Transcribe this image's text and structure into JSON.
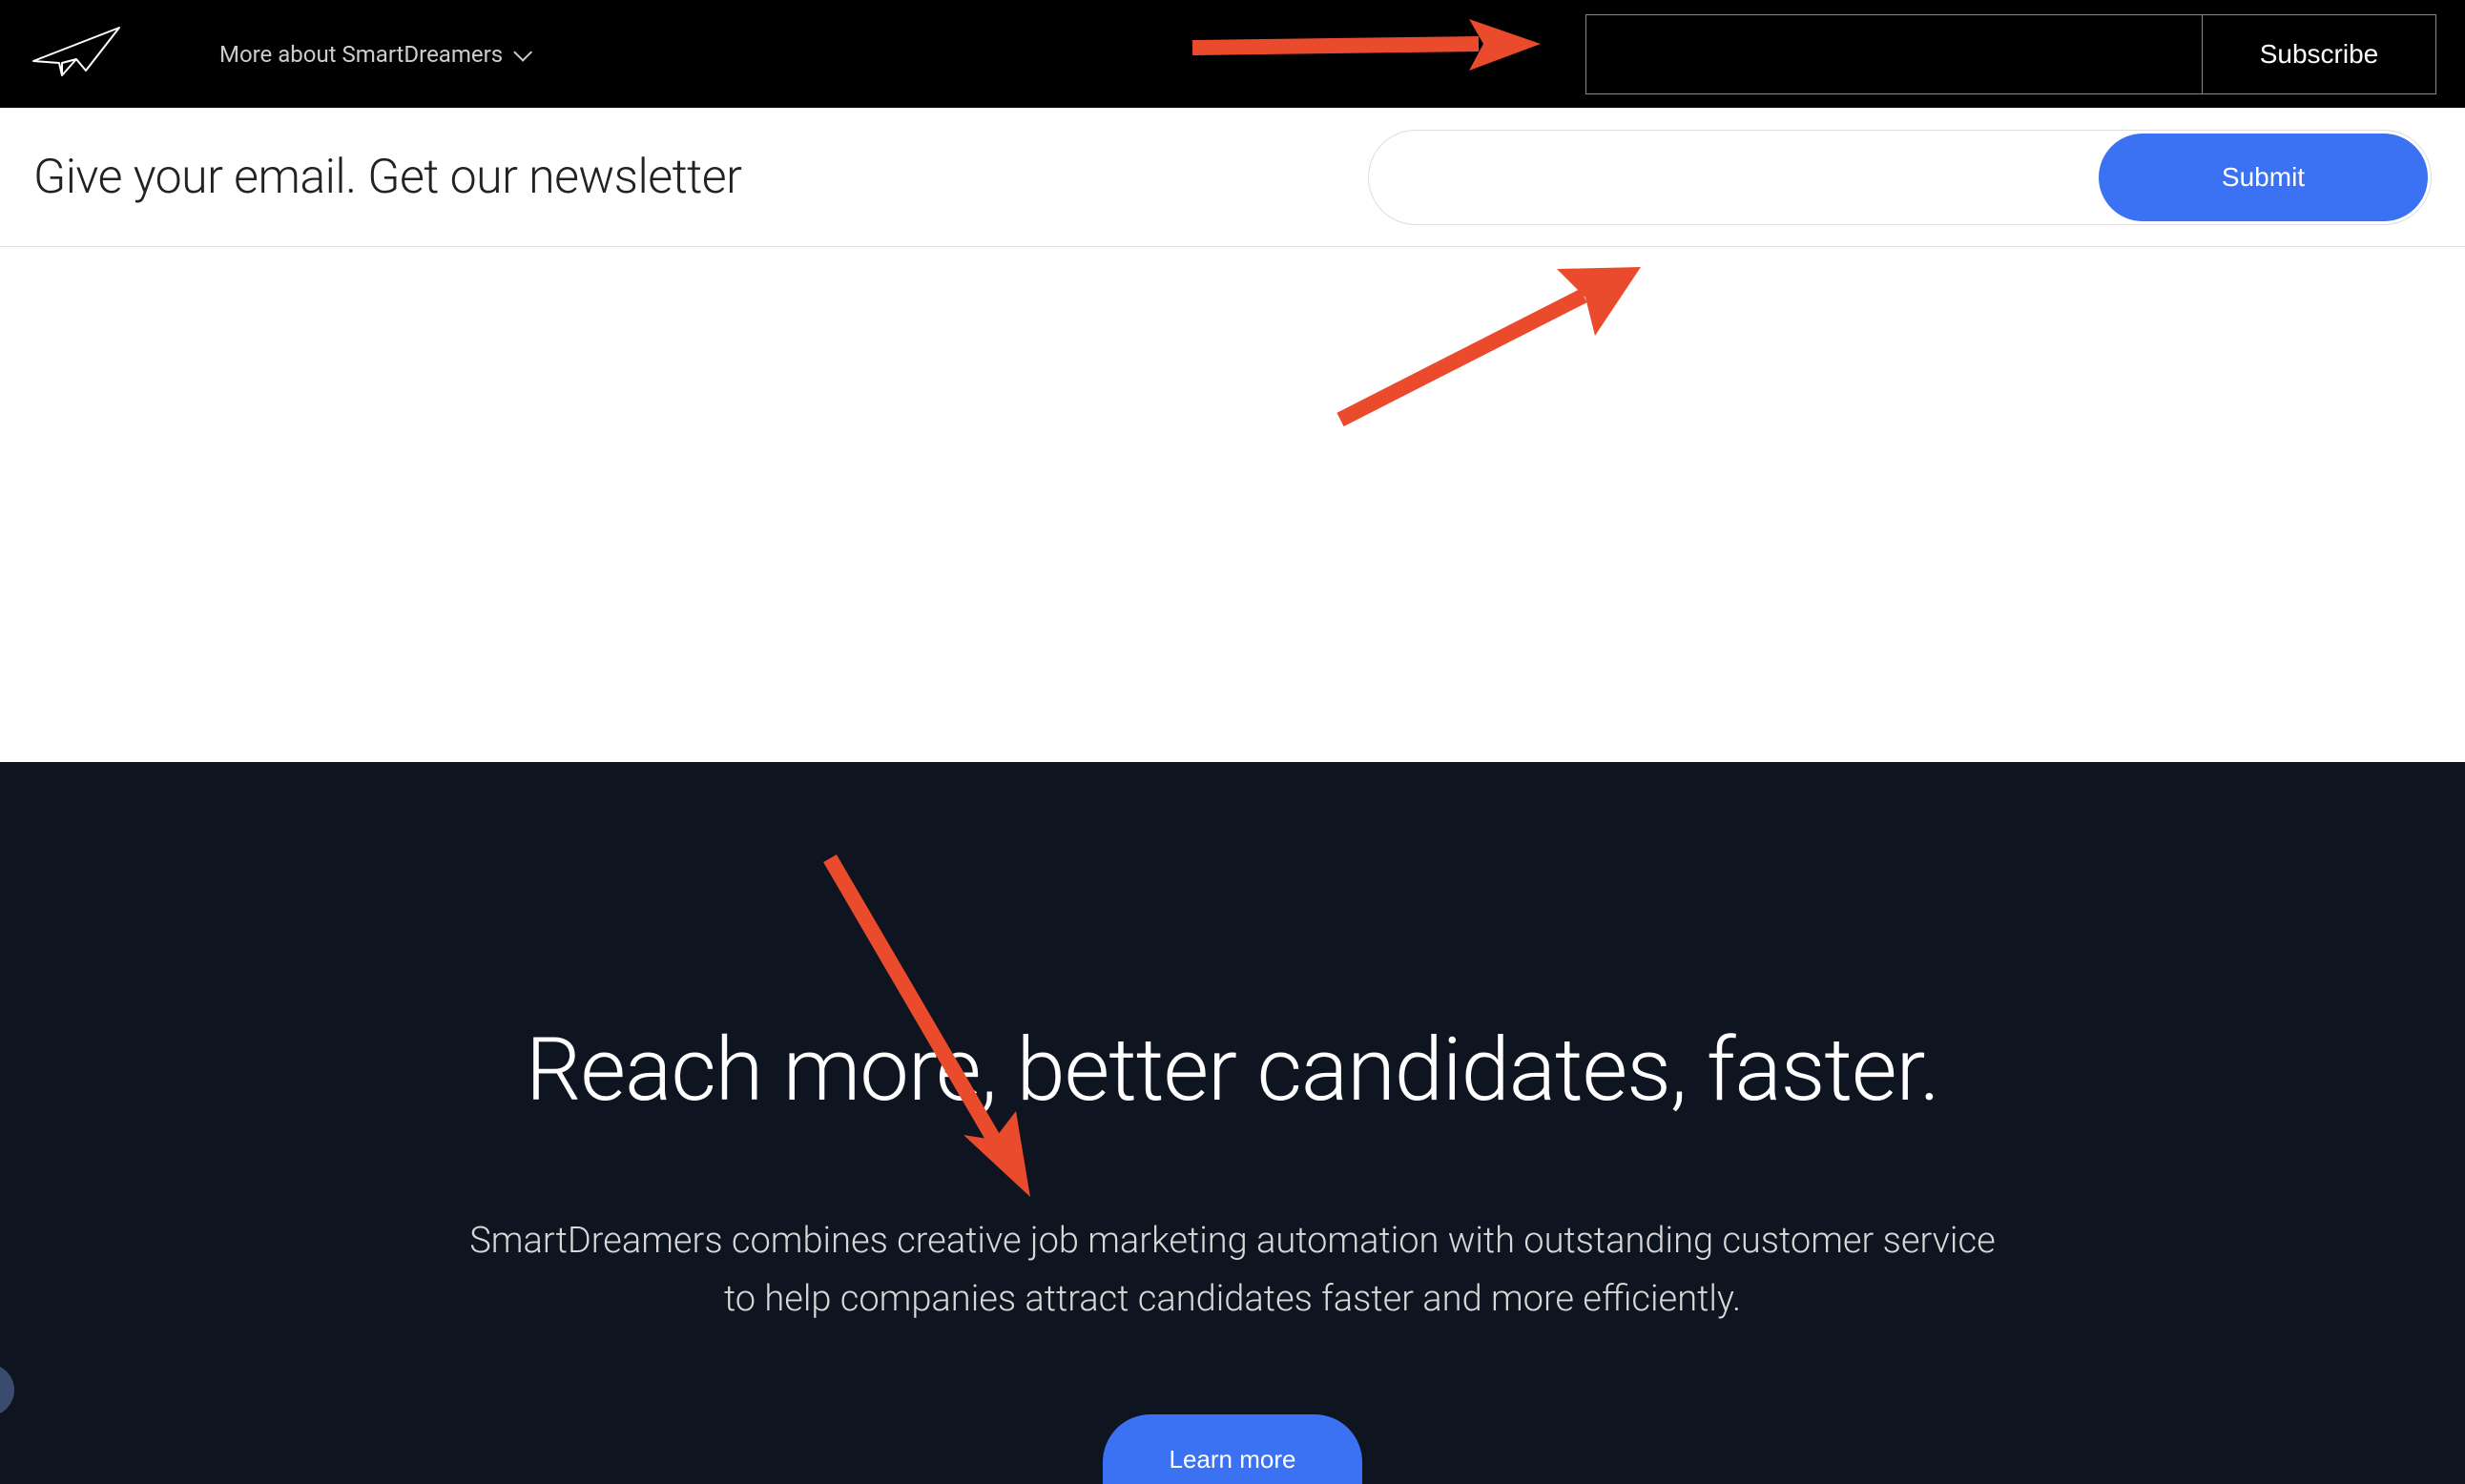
{
  "header": {
    "nav_label": "More about SmartDreamers",
    "subscribe_button": "Subscribe"
  },
  "newsletter": {
    "heading": "Give your email. Get our newsletter",
    "submit_button": "Submit"
  },
  "hero": {
    "headline": "Reach more, better candidates, faster.",
    "subtext": "SmartDreamers combines creative job marketing automation with outstanding customer service to help companies attract candidates faster and more efficiently.",
    "cta_button": "Learn more"
  },
  "annotations": {
    "arrows": [
      {
        "target": "subscribe-input",
        "color": "#e94b2c"
      },
      {
        "target": "newsletter-input",
        "color": "#e94b2c"
      },
      {
        "target": "hero-subtext",
        "color": "#e94b2c"
      }
    ]
  }
}
